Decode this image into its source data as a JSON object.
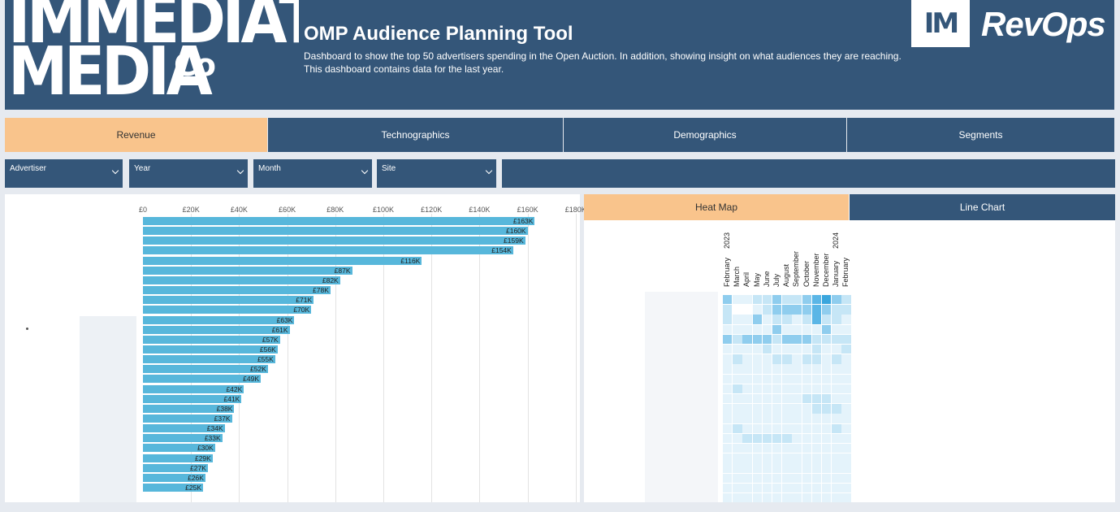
{
  "header": {
    "logo_line1": "IMMEDIATE",
    "logo_line2": "MEDIA",
    "logo_co": "Co",
    "title": "OMP Audience Planning Tool",
    "description_line1": "Dashboard to show the top 50 advertisers spending in the Open Auction. In addition, showing insight on what audiences they are reaching.",
    "description_line2": "This dashboard contains data for the last year.",
    "brand_box": "IM",
    "brand_text": "RevOps"
  },
  "nav": {
    "tabs": [
      {
        "label": "Revenue",
        "active": true
      },
      {
        "label": "Technographics",
        "active": false
      },
      {
        "label": "Demographics",
        "active": false
      },
      {
        "label": "Segments",
        "active": false
      }
    ]
  },
  "filters": [
    {
      "label": "Advertiser"
    },
    {
      "label": "Year"
    },
    {
      "label": "Month"
    },
    {
      "label": "Site"
    }
  ],
  "right_tabs": [
    {
      "label": "Heat Map",
      "active": true
    },
    {
      "label": "Line Chart",
      "active": false
    }
  ],
  "colors": {
    "header_bg": "#345679",
    "active_tab": "#f9c48c",
    "bar": "#57b7db",
    "heat_low": "#e4f3fb",
    "heat_high": "#3aa6dd"
  },
  "chart_data": [
    {
      "type": "bar",
      "orientation": "horizontal",
      "x_ticks": [
        "£0",
        "£20K",
        "£40K",
        "£60K",
        "£80K",
        "£100K",
        "£120K",
        "£140K",
        "£160K",
        "£180K"
      ],
      "xlim": [
        0,
        180
      ],
      "values": [
        163,
        160,
        159,
        154,
        116,
        87,
        82,
        78,
        71,
        70,
        63,
        61,
        57,
        56,
        55,
        52,
        49,
        42,
        41,
        38,
        37,
        34,
        33,
        30,
        29,
        27,
        26,
        25
      ],
      "labels": [
        "£163K",
        "£160K",
        "£159K",
        "£154K",
        "£116K",
        "£87K",
        "£82K",
        "£78K",
        "£71K",
        "£70K",
        "£63K",
        "£61K",
        "£57K",
        "£56K",
        "£55K",
        "£52K",
        "£49K",
        "£42K",
        "£41K",
        "£38K",
        "£37K",
        "£34K",
        "£33K",
        "£30K",
        "£29K",
        "£27K",
        "£26K",
        "£25K"
      ],
      "grid": true
    },
    {
      "type": "heatmap",
      "years": [
        {
          "label": "2023",
          "month_index": 0
        },
        {
          "label": "2024",
          "month_index": 11
        }
      ],
      "months": [
        "February",
        "March",
        "April",
        "May",
        "June",
        "July",
        "August",
        "September",
        "October",
        "November",
        "December",
        "January",
        "February"
      ],
      "rows": [
        [
          3,
          1,
          1,
          2,
          2,
          3,
          2,
          2,
          3,
          4,
          5,
          3,
          2
        ],
        [
          2,
          0,
          0,
          1,
          2,
          3,
          3,
          3,
          3,
          4,
          3,
          2,
          2
        ],
        [
          2,
          1,
          1,
          3,
          1,
          2,
          2,
          1,
          2,
          4,
          2,
          2,
          1
        ],
        [
          1,
          1,
          1,
          1,
          1,
          3,
          1,
          1,
          1,
          1,
          3,
          1,
          1
        ],
        [
          3,
          2,
          3,
          3,
          3,
          2,
          3,
          3,
          3,
          2,
          2,
          2,
          2
        ],
        [
          1,
          1,
          1,
          1,
          2,
          1,
          1,
          1,
          1,
          2,
          1,
          1,
          2
        ],
        [
          1,
          2,
          1,
          1,
          1,
          2,
          2,
          1,
          2,
          2,
          1,
          2,
          1
        ],
        [
          1,
          1,
          1,
          1,
          1,
          1,
          1,
          1,
          1,
          1,
          1,
          1,
          1
        ],
        [
          1,
          1,
          1,
          1,
          1,
          1,
          1,
          1,
          1,
          1,
          1,
          1,
          1
        ],
        [
          1,
          2,
          1,
          1,
          1,
          1,
          1,
          1,
          1,
          1,
          1,
          1,
          1
        ],
        [
          1,
          1,
          1,
          1,
          1,
          1,
          1,
          1,
          2,
          2,
          2,
          1,
          1
        ],
        [
          1,
          1,
          1,
          1,
          1,
          1,
          1,
          1,
          1,
          2,
          2,
          2,
          1
        ],
        [
          1,
          1,
          1,
          1,
          1,
          1,
          1,
          1,
          1,
          1,
          1,
          1,
          1
        ],
        [
          1,
          2,
          1,
          1,
          1,
          1,
          1,
          1,
          1,
          1,
          1,
          2,
          1
        ],
        [
          1,
          1,
          2,
          2,
          2,
          2,
          2,
          1,
          1,
          1,
          1,
          1,
          1
        ],
        [
          1,
          1,
          1,
          1,
          1,
          1,
          1,
          1,
          1,
          1,
          1,
          1,
          1
        ],
        [
          1,
          1,
          1,
          1,
          1,
          1,
          1,
          1,
          1,
          1,
          1,
          1,
          1
        ],
        [
          1,
          1,
          1,
          1,
          1,
          1,
          1,
          1,
          1,
          1,
          1,
          1,
          1
        ],
        [
          1,
          1,
          1,
          1,
          1,
          1,
          1,
          1,
          1,
          1,
          1,
          1,
          1
        ],
        [
          1,
          1,
          1,
          1,
          1,
          1,
          1,
          1,
          1,
          1,
          1,
          1,
          1
        ],
        [
          1,
          1,
          1,
          1,
          1,
          1,
          1,
          1,
          1,
          1,
          1,
          1,
          1
        ]
      ]
    }
  ]
}
